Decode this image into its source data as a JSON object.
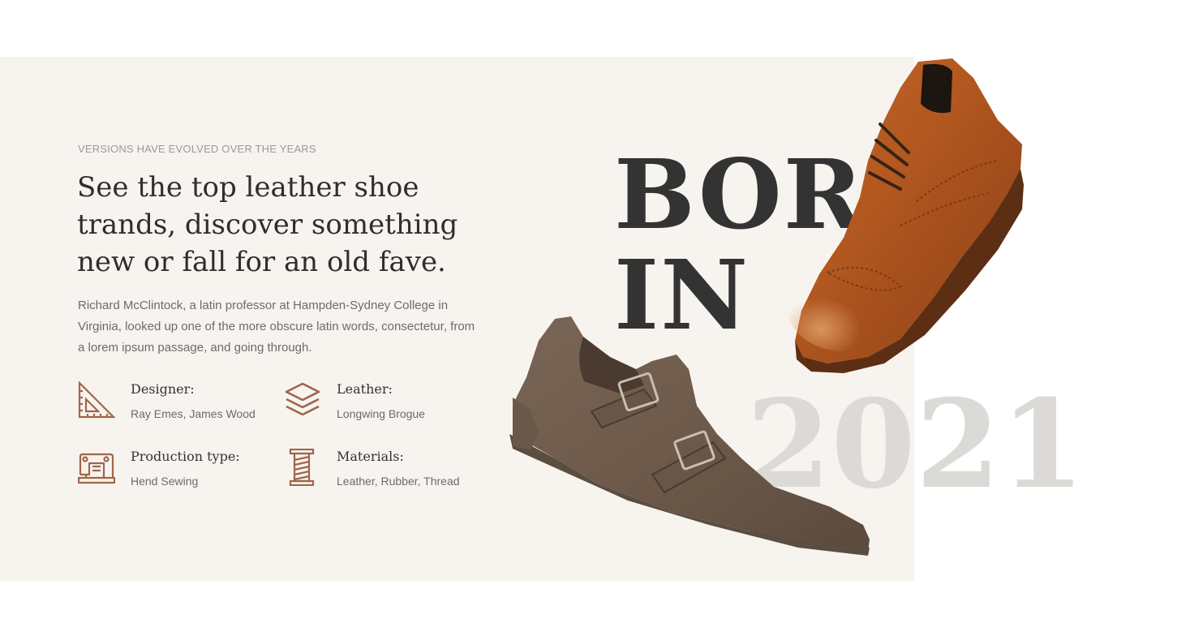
{
  "section": {
    "eyebrow": "VERSIONS HAVE EVOLVED OVER THE YEARS",
    "headline": "See the top leather shoe trands, discover something new or fall for an old fave.",
    "description": "Richard McClintock, a latin professor at Hampden-Sydney College in Virginia, looked up one of the more obscure latin words, consectetur, from a lorem ipsum passage, and going through."
  },
  "features": [
    {
      "icon": "set-square-icon",
      "title": "Designer:",
      "value": "Ray Emes, James Wood"
    },
    {
      "icon": "layers-icon",
      "title": "Leather:",
      "value": "Longwing Brogue"
    },
    {
      "icon": "sewing-machine-icon",
      "title": "Production type:",
      "value": "Hend Sewing"
    },
    {
      "icon": "thread-spool-icon",
      "title": "Materials:",
      "value": "Leather, Rubber, Thread"
    }
  ],
  "hero": {
    "word_line1": "BORN",
    "word_line2": "IN",
    "year": "2021"
  },
  "colors": {
    "panel_bg": "#f7f4ef",
    "icon_accent": "#a0654a",
    "heading": "#2e2e2e",
    "year_text": "#dcdad6"
  }
}
